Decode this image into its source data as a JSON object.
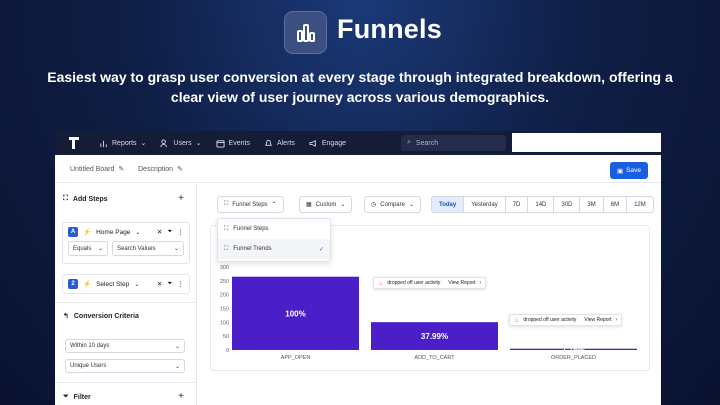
{
  "hero": {
    "title": "Funnels",
    "subtitle": "Easiest way to grasp user conversion at every stage through integrated breakdown, offering a clear view of user journey across various demographics."
  },
  "nav": {
    "items": [
      "Reports",
      "Users",
      "Events",
      "Alerts",
      "Engage"
    ],
    "search_placeholder": "Search"
  },
  "board": {
    "name": "Untitled Board",
    "description": "Description",
    "save_label": "Save"
  },
  "sidebar": {
    "add_steps_label": "Add Steps",
    "steps": [
      {
        "badge": "A",
        "event": "Home Page",
        "operator": "Equals",
        "value_placeholder": "Search Values"
      },
      {
        "badge": "2",
        "event": "Select Step"
      }
    ],
    "conversion_label": "Conversion Criteria",
    "window": "Within 10 days",
    "counting": "Unique Users",
    "filter_label": "Filter"
  },
  "controls": {
    "view": "Funnel Steps",
    "period": "Custom",
    "compare": "Compare",
    "ranges": [
      "Today",
      "Yesterday",
      "7D",
      "14D",
      "30D",
      "3M",
      "6M",
      "12M"
    ],
    "active_range": "Today",
    "view_options": [
      "Funnel Steps",
      "Funnel Trends"
    ],
    "selected_option": "Funnel Trends"
  },
  "colors": {
    "bar": "#4a1fc8",
    "accent": "#1a5fe0",
    "nav_bg": "#141c36"
  },
  "chart_data": {
    "type": "bar",
    "categories": [
      "APP_OPEN",
      "ADD_TO_CART",
      "ORDER_PLACED"
    ],
    "values": [
      100,
      37.99,
      1.75
    ],
    "labels": [
      "100%",
      "37.99%",
      "1.75%"
    ],
    "ytick_labels": [
      "0",
      "50",
      "100",
      "150",
      "200",
      "250",
      "300"
    ],
    "ylim": [
      0,
      300
    ],
    "y_scale_per_percent": 2.65,
    "dropoff_text": "dropped off user activity",
    "view_report": "View Report"
  }
}
